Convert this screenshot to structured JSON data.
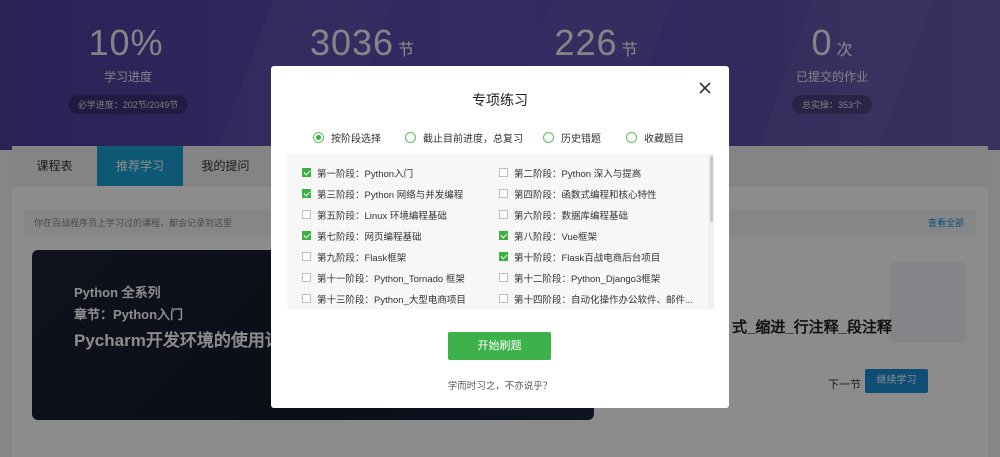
{
  "stats": [
    {
      "value": "10%",
      "unit": "",
      "label": "学习进度",
      "pill": "必学进度：202节/2049节"
    },
    {
      "value": "3036",
      "unit": "节",
      "label": "",
      "pill": ""
    },
    {
      "value": "226",
      "unit": "节",
      "label": "",
      "pill": ""
    },
    {
      "value": "0",
      "unit": "次",
      "label": "已提交的作业",
      "pill": "总实操：353个"
    }
  ],
  "tabs": [
    "课程表",
    "推荐学习",
    "我的提问"
  ],
  "notice": {
    "text": "你在百战程序员上学习过的课程，都会记录到这里",
    "view_all": "查看全部"
  },
  "course": {
    "series": "Python 全系列",
    "chapter": "章节：Python入门",
    "lesson": "Pycharm开发环境的使用详解"
  },
  "right_lesson_title": "式_缩进_行注释_段注释",
  "next_label": "下一节",
  "continue_label": "继续学习",
  "modal": {
    "title": "专项练习",
    "radios": [
      {
        "label": "按阶段选择",
        "selected": true
      },
      {
        "label": "截止目前进度，总复习",
        "selected": false
      },
      {
        "label": "历史错题",
        "selected": false
      },
      {
        "label": "收藏题目",
        "selected": false
      }
    ],
    "stages": [
      {
        "label": "第一阶段：Python入门",
        "checked": true
      },
      {
        "label": "第二阶段：Python 深入与提高",
        "checked": false
      },
      {
        "label": "第三阶段：Python 网络与并发编程",
        "checked": true
      },
      {
        "label": "第四阶段：函数式编程和核心特性",
        "checked": false
      },
      {
        "label": "第五阶段：Linux 环境编程基础",
        "checked": false
      },
      {
        "label": "第六阶段：数据库编程基础",
        "checked": false
      },
      {
        "label": "第七阶段：网页编程基础",
        "checked": true
      },
      {
        "label": "第八阶段：Vue框架",
        "checked": true
      },
      {
        "label": "第九阶段：Flask框架",
        "checked": false
      },
      {
        "label": "第十阶段：Flask百战电商后台项目",
        "checked": true
      },
      {
        "label": "第十一阶段：Python_Tornado 框架",
        "checked": false
      },
      {
        "label": "第十二阶段：Python_Django3框架",
        "checked": false
      },
      {
        "label": "第十三阶段：Python_大型电商项目",
        "checked": false
      },
      {
        "label": "第十四阶段：自动化操作办公软件、邮件...",
        "checked": false
      }
    ],
    "start_label": "开始刷题",
    "motto": "学而时习之，不亦说乎？"
  },
  "colors": {
    "accent_green": "#3db24a",
    "tab_blue": "#1aa0d6",
    "hero_purple": "#4a3f9c"
  }
}
